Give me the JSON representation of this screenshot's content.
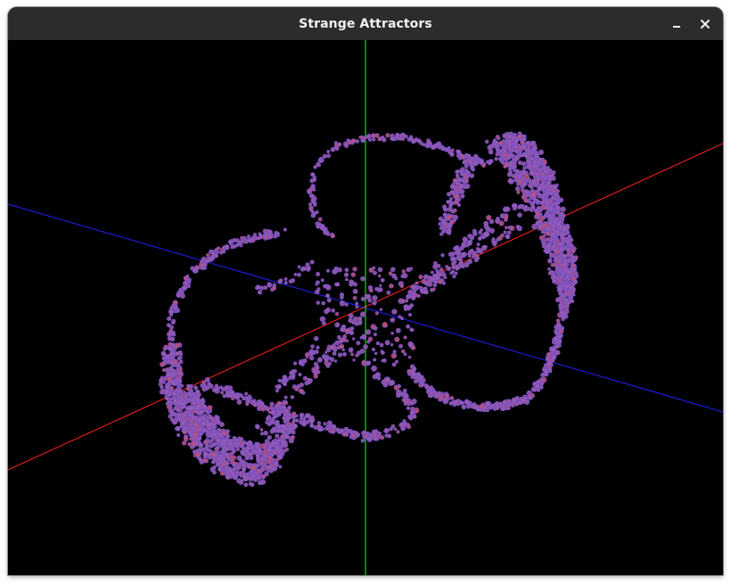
{
  "window": {
    "title": "Strange Attractors"
  },
  "controls": {
    "minimize_icon": "minimize-icon",
    "close_icon": "close-icon"
  },
  "scene": {
    "background_color": "#000000",
    "axis_colors": {
      "x_axis": "#ff2020",
      "y_axis": "#20ff20",
      "z_axis": "#2020ff"
    },
    "point_color": "#9a5ab0",
    "point_stroke_color": "#6c4fc8",
    "point_highlight_color": "#c0507a"
  }
}
